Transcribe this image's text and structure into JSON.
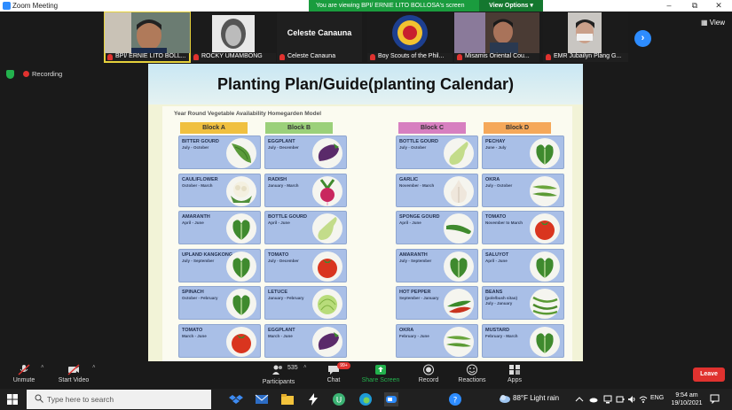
{
  "window": {
    "title": "Zoom Meeting"
  },
  "share_banner": {
    "message": "You are viewing BPI/ ERNIE LITO BOLLOSA's screen",
    "view_options": "View Options"
  },
  "participants": [
    {
      "name": "BPI/ ERNIE LITO BOLL...",
      "kind": "video"
    },
    {
      "name": "ROCKY UMAMBONG",
      "kind": "photo"
    },
    {
      "name": "Celeste Canauna",
      "kind": "text",
      "display": "Celeste Canauna"
    },
    {
      "name": "Boy Scouts of the Phil...",
      "kind": "logo"
    },
    {
      "name": "Misamis Oriental Cou...",
      "kind": "video"
    },
    {
      "name": "EMR Jubailyn Plang G...",
      "kind": "video"
    }
  ],
  "view_label": "View",
  "recording_label": "Recording",
  "slide": {
    "title": "Planting Plan/Guide(planting Calendar)",
    "subtitle": "Year Round Vegetable Availability Homegarden Model",
    "blocks": [
      {
        "label": "Block A",
        "color": "#f0c040",
        "items": [
          {
            "name": "BITTER GOURD",
            "period": "July - October",
            "veg": "bittergourd"
          },
          {
            "name": "CAULIFLOWER",
            "period": "October - March",
            "veg": "cauliflower"
          },
          {
            "name": "AMARANTH",
            "period": "April - June",
            "veg": "leafy"
          },
          {
            "name": "UPLAND KANGKONG",
            "period": "July - September",
            "veg": "leafy"
          },
          {
            "name": "SPINACH",
            "period": "October - February",
            "veg": "leafy"
          },
          {
            "name": "TOMATO",
            "period": "March - June",
            "veg": "tomato"
          }
        ]
      },
      {
        "label": "Block B",
        "color": "#9bd07a",
        "items": [
          {
            "name": "EGGPLANT",
            "period": "July - December",
            "veg": "eggplant"
          },
          {
            "name": "RADISH",
            "period": "January - March",
            "veg": "radish"
          },
          {
            "name": "BOTTLE GOURD",
            "period": "April - June",
            "veg": "bottlegourd"
          },
          {
            "name": "TOMATO",
            "period": "July - December",
            "veg": "tomato"
          },
          {
            "name": "LETUCE",
            "period": "January - February",
            "veg": "lettuce"
          },
          {
            "name": "EGGPLANT",
            "period": "March - June",
            "veg": "eggplant"
          }
        ]
      },
      {
        "label": "Block C",
        "color": "#d77fc0",
        "items": [
          {
            "name": "BOTTLE GOURD",
            "period": "July - October",
            "veg": "bottlegourd"
          },
          {
            "name": "GARLIC",
            "period": "November - March",
            "veg": "garlic"
          },
          {
            "name": "SPONGE GOURD",
            "period": "April - June",
            "veg": "spongegourd"
          },
          {
            "name": "AMARANTH",
            "period": "July - September",
            "veg": "leafy"
          },
          {
            "name": "HOT PEPPER",
            "period": "September - January",
            "veg": "pepper"
          },
          {
            "name": "OKRA",
            "period": "February - June",
            "veg": "okra"
          }
        ]
      },
      {
        "label": "Block D",
        "color": "#f5a85a",
        "items": [
          {
            "name": "PECHAY",
            "period": "June - July",
            "veg": "leafy"
          },
          {
            "name": "OKRA",
            "period": "July - October",
            "veg": "okra"
          },
          {
            "name": "TOMATO",
            "period": "November to March",
            "veg": "tomato"
          },
          {
            "name": "SALUYOT",
            "period": "April - June",
            "veg": "leafy"
          },
          {
            "name": "BEANS",
            "period": "(pole/bush sitao)",
            "period2": "July - January",
            "veg": "beans"
          },
          {
            "name": "MUSTARD",
            "period": "February - March",
            "veg": "leafy"
          }
        ]
      }
    ]
  },
  "toolbar": {
    "unmute": "Unmute",
    "start_video": "Start Video",
    "participants": "Participants",
    "participant_count": "535",
    "chat": "Chat",
    "chat_badge": "99+",
    "share_screen": "Share Screen",
    "record": "Record",
    "reactions": "Reactions",
    "apps": "Apps",
    "leave": "Leave"
  },
  "taskbar": {
    "search_placeholder": "Type here to search",
    "weather": "88°F  Light rain",
    "language": "ENG",
    "time": "9:54 am",
    "date": "19/10/2021"
  }
}
